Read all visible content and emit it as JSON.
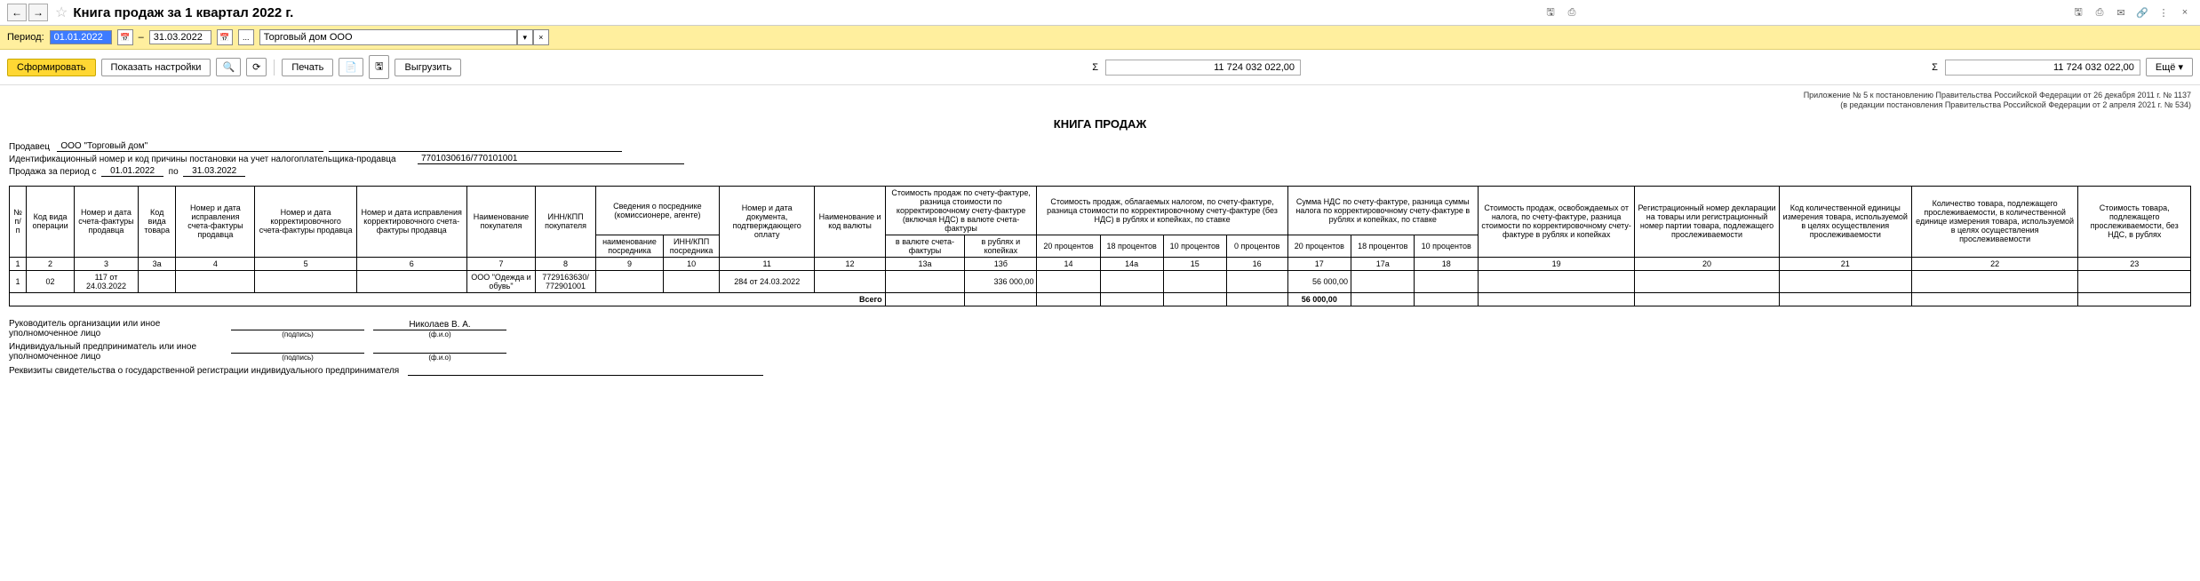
{
  "title": "Книга продаж за 1 квартал 2022 г.",
  "period": {
    "label": "Период:",
    "from": "01.01.2022",
    "sep": "–",
    "to": "31.03.2022",
    "ellipsis": "...",
    "org": "Торговый дом ООО"
  },
  "toolbar": {
    "form": "Сформировать",
    "settings": "Показать настройки",
    "print": "Печать",
    "export": "Выгрузить",
    "sum1": "11 724 032 022,00",
    "sum2": "11 724 032 022,00",
    "more": "Ещё"
  },
  "reg": {
    "l1": "Приложение № 5 к постановлению Правительства Российской Федерации от 26 декабря 2011 г. № 1137",
    "l2": "(в редакции постановления Правительства Российской Федерации от 2 апреля 2021 г. № 534)"
  },
  "reportTitle": "КНИГА ПРОДАЖ",
  "seller": {
    "label": "Продавец",
    "name": "ООО \"Торговый дом\"",
    "innLabel": "Идентификационный номер и код причины постановки на учет налогоплательщика-продавца",
    "inn": "7701030616/770101001",
    "periodLabel": "Продажа за период с",
    "from": "01.01.2022",
    "toLabel": "по",
    "to": "31.03.2022"
  },
  "headers": {
    "c1": "№ п/п",
    "c2": "Код вида операции",
    "c3": "Номер и дата счета-фактуры продавца",
    "c3a": "Код вида товара",
    "c4": "Номер и дата исправления счета-фактуры продавца",
    "c5": "Номер и дата корректировочного счета-фактуры продавца",
    "c6": "Номер и дата исправления корректировочного счета-фактуры продавца",
    "c7": "Наименование покупателя",
    "c8": "ИНН/КПП покупателя",
    "c9g": "Сведения о посреднике (комиссионере, агенте)",
    "c9": "наименование посредника",
    "c10": "ИНН/КПП посредника",
    "c11": "Номер и дата документа, подтверждающего оплату",
    "c12": "Наименование и код валюты",
    "c13g": "Стоимость продаж по счету-фактуре, разница стоимости по корректировочному счету-фактуре (включая НДС) в валюте счета-фактуры",
    "c13a": "в валюте счета-фактуры",
    "c13b": "в рублях и копейках",
    "c14g": "Стоимость продаж, облагаемых налогом, по счету-фактуре, разница стоимости по корректировочному счету-фактуре (без НДС) в рублях и копейках, по ставке",
    "c14": "20 процентов",
    "c14a": "18 процентов",
    "c15": "10 процентов",
    "c16": "0 процентов",
    "c17g": "Сумма НДС по счету-фактуре, разница суммы налога по корректировочному счету-фактуре в рублях и копейках, по ставке",
    "c17": "20 процентов",
    "c17a": "18 процентов",
    "c18": "10 процентов",
    "c19": "Стоимость продаж, освобождаемых от налога, по счету-фактуре, разница стоимости по корректировочному счету-фактуре в рублях и копейках",
    "c20": "Регистрационный номер декларации на товары или регистрационный номер партии товара, подлежащего прослеживаемости",
    "c21": "Код количественной единицы измерения товара, используемой в целях осуществления прослеживаемости",
    "c22": "Количество товара, подлежащего прослеживаемости, в количественной единице измерения товара, используемой в целях осуществления прослеживаемости",
    "c23": "Стоимость товара, подлежащего прослеживаемости, без НДС, в рублях"
  },
  "nums": [
    "1",
    "2",
    "3",
    "3а",
    "4",
    "5",
    "6",
    "7",
    "8",
    "9",
    "10",
    "11",
    "12",
    "13а",
    "13б",
    "14",
    "14а",
    "15",
    "16",
    "17",
    "17а",
    "18",
    "19",
    "20",
    "21",
    "22",
    "23"
  ],
  "row": {
    "n": "1",
    "op": "02",
    "sf": "117 от 24.03.2022",
    "buyer": "ООО \"Одежда и обувь\"",
    "inn": "7729163630/ 772901001",
    "doc": "284 от 24.03.2022",
    "sum13b": "336 000,00",
    "vat17": "56 000,00"
  },
  "total": {
    "label": "Всего",
    "vat17": "56 000,00"
  },
  "sig": {
    "head": "Руководитель организации или иное уполномоченное лицо",
    "ip": "Индивидуальный предприниматель или иное уполномоченное лицо",
    "podpis": "(подпись)",
    "fio": "(ф.и.о)",
    "name": "Николаев В. А.",
    "req": "Реквизиты свидетельства о государственной регистрации индивидуального предпринимателя"
  }
}
